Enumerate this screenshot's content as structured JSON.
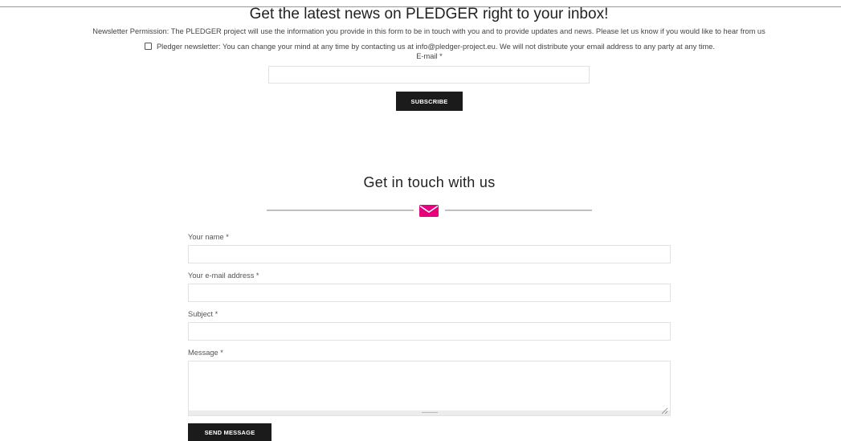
{
  "newsletter": {
    "title": "Get the latest news on PLEDGER right to your inbox!",
    "permission_text": "Newsletter Permission: The PLEDGER project will use the information you provide in this form to be in touch with you and to provide updates and news. Please let us know if you would like to hear from us",
    "consent_text": "Pledger newsletter: You can change your mind at any time by contacting us at info@pledger-project.eu. We will not distribute your email address to any party at any time.",
    "consent_checked": false,
    "email_label": "E-mail *",
    "email_value": "",
    "subscribe_label": "SUBSCRIBE"
  },
  "contact": {
    "title": "Get in touch with us",
    "icon": "envelope-icon",
    "accent_color": "#e6007e",
    "name_label": "Your name *",
    "name_value": "",
    "email_label": "Your e-mail address *",
    "email_value": "",
    "subject_label": "Subject *",
    "subject_value": "",
    "message_label": "Message *",
    "message_value": "",
    "send_label": "SEND MESSAGE"
  }
}
